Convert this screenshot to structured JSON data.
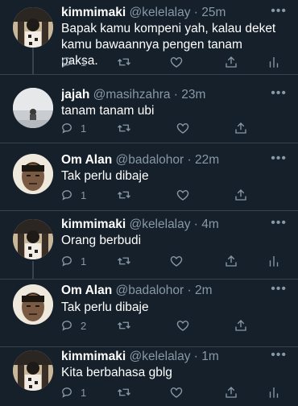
{
  "tweets": [
    {
      "name": "kimmimaki",
      "handle": "@kelelalay",
      "time": "25m",
      "text": "Bapak kamu kompeni yah, kalau deket kamu bawaannya pengen tanam paksa.",
      "replies": "1",
      "avatar": "kimmimaki",
      "analytics": true
    },
    {
      "name": "jajah",
      "handle": "@masihzahra",
      "time": "23m",
      "text": "tanam tanam ubi",
      "replies": "1",
      "avatar": "jajah",
      "analytics": false
    },
    {
      "name": "Om Alan",
      "handle": "@badalohor",
      "time": "22m",
      "text": "Tak perlu dibaje",
      "replies": "1",
      "avatar": "omalan",
      "analytics": false
    },
    {
      "name": "kimmimaki",
      "handle": "@kelelalay",
      "time": "4m",
      "text": "Orang berbudi",
      "replies": "1",
      "avatar": "kimmimaki",
      "analytics": true
    },
    {
      "name": "Om Alan",
      "handle": "@badalohor",
      "time": "2m",
      "text": "Tak perlu dibaje",
      "replies": "2",
      "avatar": "omalan",
      "analytics": false
    },
    {
      "name": "kimmimaki",
      "handle": "@kelelalay",
      "time": "1m",
      "text": "Kita berbahasa gblg",
      "replies": "1",
      "avatar": "kimmimaki",
      "analytics": true
    }
  ],
  "ui": {
    "separator": " · ",
    "more_glyph": "•••"
  },
  "colors": {
    "background": "#15202b",
    "muted": "#8899a6",
    "divider": "#38444d",
    "text": "#ffffff"
  },
  "icons": [
    "reply-icon",
    "retweet-icon",
    "like-icon",
    "share-icon",
    "analytics-icon",
    "more-icon"
  ]
}
